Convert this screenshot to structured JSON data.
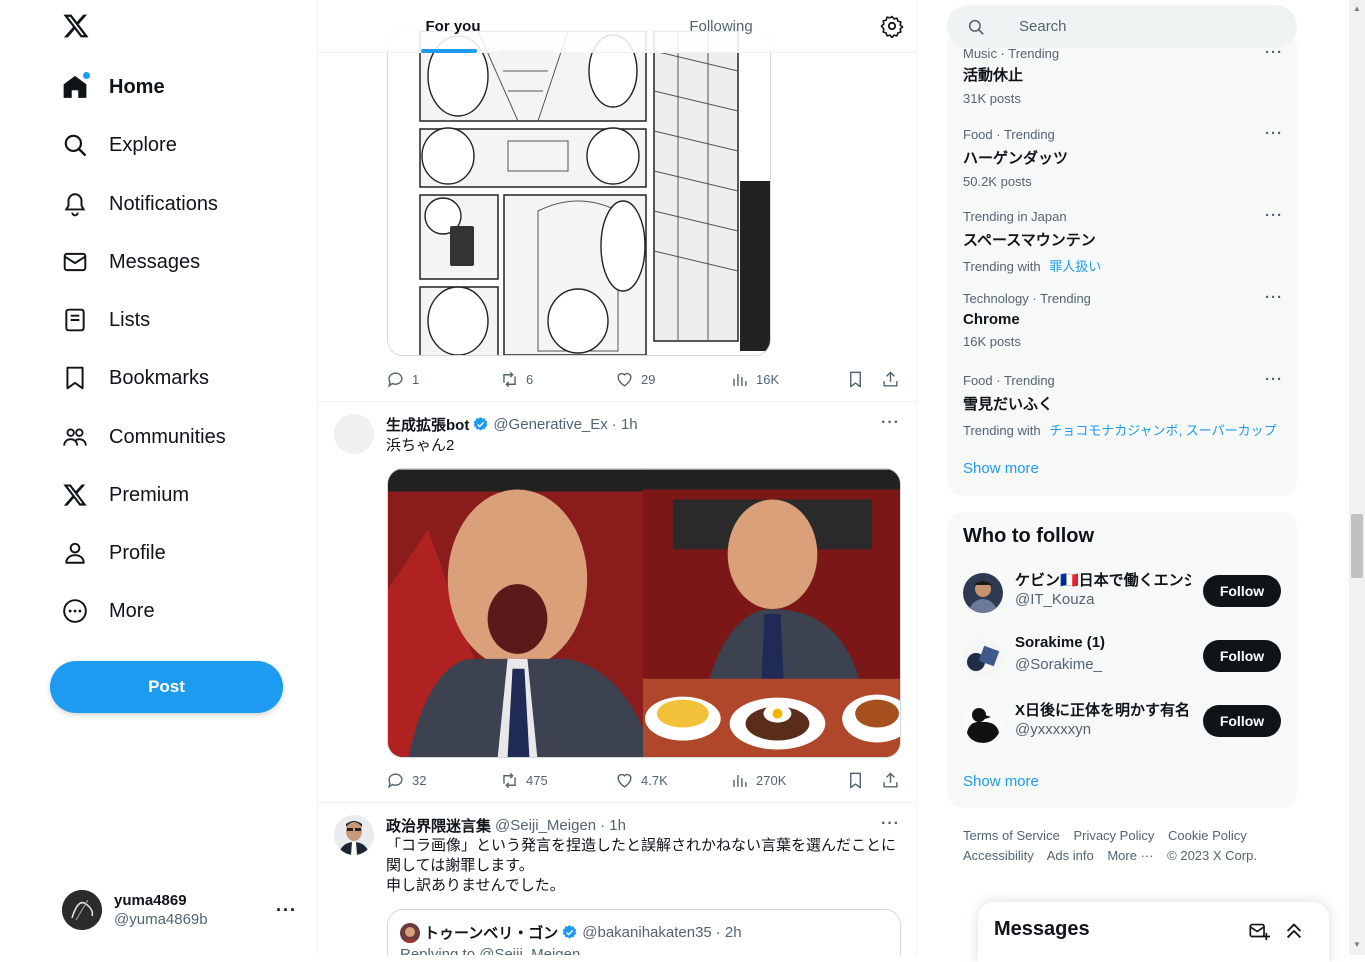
{
  "nav": {
    "items": [
      {
        "label": "Home",
        "icon": "home-icon"
      },
      {
        "label": "Explore",
        "icon": "search-icon"
      },
      {
        "label": "Notifications",
        "icon": "bell-icon"
      },
      {
        "label": "Messages",
        "icon": "envelope-icon"
      },
      {
        "label": "Lists",
        "icon": "list-icon"
      },
      {
        "label": "Bookmarks",
        "icon": "bookmark-icon"
      },
      {
        "label": "Communities",
        "icon": "people-icon"
      },
      {
        "label": "Premium",
        "icon": "x-logo-icon"
      },
      {
        "label": "Profile",
        "icon": "person-icon"
      },
      {
        "label": "More",
        "icon": "more-circle-icon"
      }
    ],
    "post_label": "Post"
  },
  "account": {
    "name": "yuma4869",
    "handle": "@yuma4869b"
  },
  "tabs": {
    "for_you": "For you",
    "following": "Following"
  },
  "tweets": [
    {
      "replies": "1",
      "reposts": "6",
      "likes": "29",
      "views": "16K"
    },
    {
      "name": "生成拡張bot",
      "handle": "@Generative_Ex",
      "time": "· 1h",
      "text": "浜ちゃん2",
      "replies": "32",
      "reposts": "475",
      "likes": "4.7K",
      "views": "270K"
    },
    {
      "name": "政治界隈迷言集",
      "handle": "@Seiji_Meigen",
      "time": "· 1h",
      "text_line1": "「コラ画像」という発言を捏造したと誤解されかねない言葉を選んだことに",
      "text_line2": "関しては謝罪します。",
      "text_line3": "申し訳ありませんでした。",
      "quote": {
        "name": "トゥーンベリ・ゴン",
        "handle": "@bakanihakaten35",
        "time": "· 2h",
        "text": "Replying to @Seiji_Meigen"
      }
    }
  ],
  "search": {
    "placeholder": "Search"
  },
  "trends": [
    {
      "context": "Music · Trending",
      "title": "活動休止",
      "sub": "31K posts"
    },
    {
      "context": "Food · Trending",
      "title": "ハーゲンダッツ",
      "sub": "50.2K posts"
    },
    {
      "context": "Trending in Japan",
      "title": "スペースマウンテン",
      "sub_prefix": "Trending with",
      "links": [
        "罪人扱い"
      ]
    },
    {
      "context": "Technology · Trending",
      "title": "Chrome",
      "sub": "16K posts"
    },
    {
      "context": "Food · Trending",
      "title": "雪見だいふく",
      "sub_prefix": "Trending with",
      "links": [
        "チョコモナカジャンボ",
        "スーパーカップ"
      ]
    }
  ],
  "trends_show_more": "Show more",
  "who_to_follow": {
    "title": "Who to follow",
    "users": [
      {
        "name": "ケビン🇫🇷日本で働くエンジ",
        "handle": "@IT_Kouza"
      },
      {
        "name": "Sorakime (1)",
        "handle": "@Sorakime_"
      },
      {
        "name": "X日後に正体を明かす有名",
        "handle": "@yxxxxxyn"
      }
    ],
    "follow_label": "Follow",
    "show_more": "Show more"
  },
  "footer": {
    "links": [
      "Terms of Service",
      "Privacy Policy",
      "Cookie Policy",
      "Accessibility",
      "Ads info",
      "More ···"
    ],
    "copyright": "© 2023 X Corp."
  },
  "messages_drawer": {
    "title": "Messages"
  },
  "colors": {
    "accent": "#1d9bf0",
    "text": "#0f1419",
    "muted": "#536471"
  }
}
